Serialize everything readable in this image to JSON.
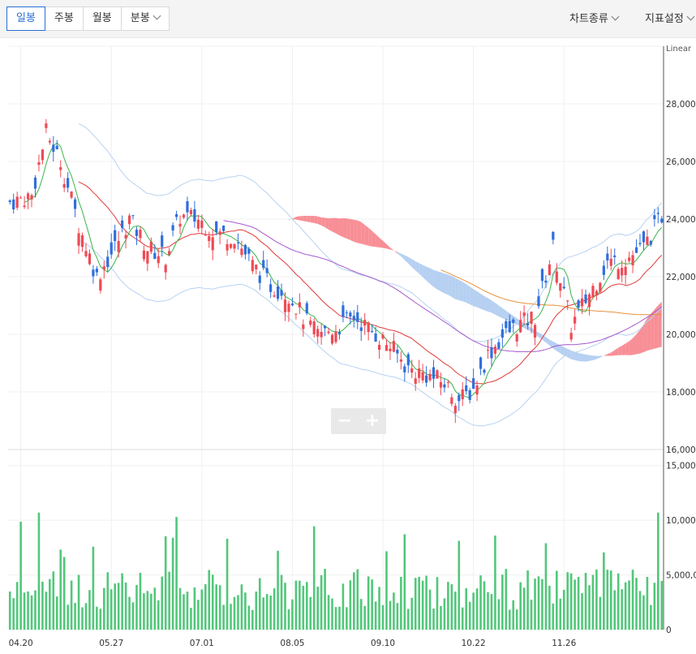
{
  "toolbar": {
    "tabs": [
      {
        "label": "일봉",
        "active": true
      },
      {
        "label": "주봉",
        "active": false
      },
      {
        "label": "월봉",
        "active": false
      },
      {
        "label": "분봉",
        "active": false
      }
    ],
    "chart_type_label": "차트종류",
    "indicator_label": "지표설정"
  },
  "zoom": {
    "minus": "−",
    "plus": "+"
  },
  "colors": {
    "up": "#f04a55",
    "down": "#2f6fdc",
    "volume": "#52c77a",
    "ma5": "#39b54a",
    "ma20": "#e03b3b",
    "ma60": "#a55ad0",
    "ma120": "#e8913a",
    "cloud_bull": "#f77b84",
    "cloud_bear": "#a9c8f0",
    "band": "#b8d2f2"
  },
  "chart_data": {
    "type": "candlestick",
    "scale_label": "Linear",
    "price_axis": {
      "min": 16000,
      "max": 30000,
      "ticks": [
        "16,000",
        "18,000",
        "20,000",
        "22,000",
        "24,000",
        "26,000",
        "28,000"
      ]
    },
    "volume_axis": {
      "min": 0,
      "max": 15500000,
      "ticks": [
        "0",
        "5,000,000",
        "10,000,000",
        "15,000,000"
      ]
    },
    "x_labels": [
      {
        "label": "04.20",
        "index": 3
      },
      {
        "label": "05.27",
        "index": 28
      },
      {
        "label": "07.01",
        "index": 53
      },
      {
        "label": "08.05",
        "index": 78
      },
      {
        "label": "09.10",
        "index": 103
      },
      {
        "label": "10.22",
        "index": 128
      },
      {
        "label": "11.26",
        "index": 153
      }
    ],
    "bars": 181,
    "series_indicators": [
      "MA5",
      "MA20",
      "MA60",
      "MA120",
      "Ichimoku cloud",
      "Envelope bands"
    ]
  }
}
